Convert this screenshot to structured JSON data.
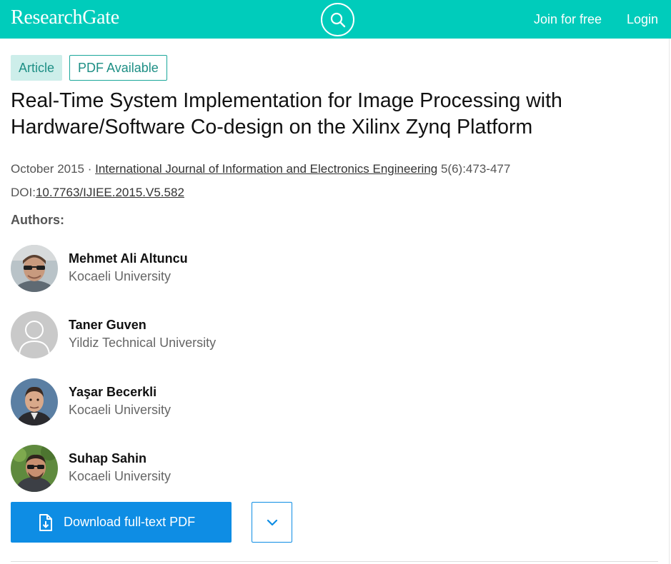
{
  "header": {
    "logo": "ResearchGate",
    "join_label": "Join for free",
    "login_label": "Login",
    "search_icon": "search-icon",
    "bg_color": "#00ccbb"
  },
  "badges": {
    "article": "Article",
    "pdf_available": "PDF Available"
  },
  "article": {
    "title": "Real-Time System Implementation for Image Processing with Hardware/Software Co-design on the Xilinx Zynq Platform",
    "date": "October 2015",
    "separator": " · ",
    "journal": "International Journal of Information and Electronics Engineering",
    "volume_pages": " 5(6):473-477",
    "doi_prefix": "DOI:",
    "doi": "10.7763/IJIEE.2015.V5.582"
  },
  "authors_heading": "Authors:",
  "authors": [
    {
      "name": "Mehmet Ali Altuncu",
      "institution": "Kocaeli University",
      "avatar": "photo"
    },
    {
      "name": "Taner Guven",
      "institution": "Yildiz Technical University",
      "avatar": "placeholder-person-icon"
    },
    {
      "name": "Yaşar Becerkli",
      "institution": "Kocaeli University",
      "avatar": "photo"
    },
    {
      "name": "Suhap Sahin",
      "institution": "Kocaeli University",
      "avatar": "photo"
    }
  ],
  "actions": {
    "download_label": "Download full-text PDF",
    "download_icon": "pdf-download-icon",
    "more_icon": "chevron-down-icon",
    "accent_color": "#0e8de4"
  }
}
